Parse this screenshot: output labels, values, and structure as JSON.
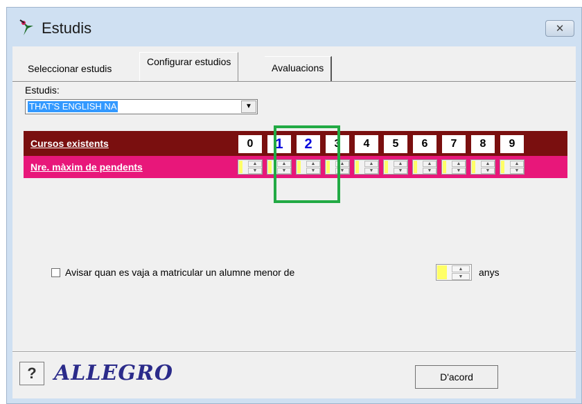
{
  "window": {
    "title": "Estudis",
    "close_glyph": "✕"
  },
  "tabs": [
    "Seleccionar estudis",
    "Configurar estudios",
    "Avaluacions"
  ],
  "active_tab": "Configurar estudios",
  "estudis": {
    "label": "Estudis:",
    "selected": "THAT'S ENGLISH NA",
    "dropdown_glyph": "▼"
  },
  "grid": {
    "row1_label": "Cursos existents",
    "row2_label": "Nre. màxim de pendents",
    "courses": [
      "0",
      "1",
      "2",
      "3",
      "4",
      "5",
      "6",
      "7",
      "8",
      "9"
    ],
    "highlighted_courses": [
      "1",
      "2"
    ]
  },
  "warning": {
    "label": "Avisar quan es vaja a matricular un alumne menor de",
    "checked": false,
    "unit": "anys"
  },
  "footer": {
    "help_label": "?",
    "logo_text": "ALLEGRO",
    "ok_label": "D'acord"
  },
  "colors": {
    "row1_bg": "#7a0f0f",
    "row2_bg": "#e8177a",
    "highlight": "#22aa44"
  },
  "icons": [
    "app-bird-icon",
    "close-icon",
    "dropdown-arrow-icon",
    "spin-up-icon",
    "spin-down-icon",
    "help-icon"
  ]
}
